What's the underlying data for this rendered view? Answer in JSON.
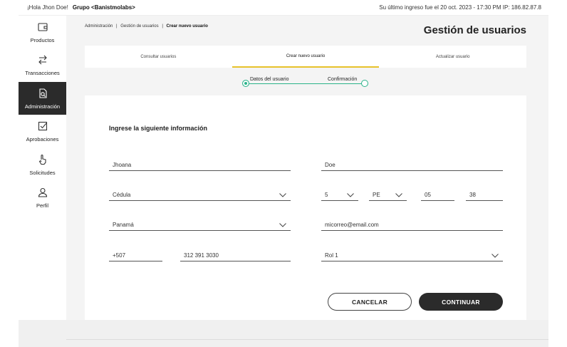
{
  "topbar": {
    "greeting": "¡Hola Jhon Doe!",
    "group": "Grupo <Banistmolabs>",
    "last_login": "Su último ingreso fue el 20 oct. 2023 - 17:30 PM IP: 186.82.87.8"
  },
  "sidebar": {
    "items": [
      {
        "label": "Productos",
        "icon": "wallet-icon"
      },
      {
        "label": "Transacciones",
        "icon": "transfer-arrows-icon"
      },
      {
        "label": "Administración",
        "icon": "document-search-icon",
        "active": true
      },
      {
        "label": "Aprobaciones",
        "icon": "checkbox-icon"
      },
      {
        "label": "Solicitudes",
        "icon": "hand-pointer-icon"
      },
      {
        "label": "Perfil",
        "icon": "user-icon"
      }
    ]
  },
  "breadcrumb": {
    "item1": "Administración",
    "item2": "Gestión de usuarios",
    "current": "Crear nuevo usuario",
    "sep": "|"
  },
  "page_title": "Gestión de usuarios",
  "tabs": [
    {
      "label": "Consultar usuarios"
    },
    {
      "label": "Crear nuevo usuario",
      "active": true
    },
    {
      "label": "Actualizar usuario"
    }
  ],
  "stepper": {
    "step1": "Datos del usuario",
    "step2": "Confirmación"
  },
  "form": {
    "heading": "Ingrese la siguiente información",
    "first_name": "Jhoana",
    "last_name": "Doe",
    "id_type": "Cédula",
    "id_part1": "5",
    "id_part2": "PE",
    "id_part3": "05",
    "id_part4": "38",
    "country": "Panamá",
    "email": "micorreo@email.com",
    "phone_code": "+507",
    "phone_number": "312 391 3030",
    "role": "Rol 1"
  },
  "buttons": {
    "cancel": "CANCELAR",
    "continue": "CONTINUAR"
  },
  "colors": {
    "accent_yellow": "#e7c22b",
    "step_green": "#2bb38a",
    "dark": "#2b2b2b"
  }
}
